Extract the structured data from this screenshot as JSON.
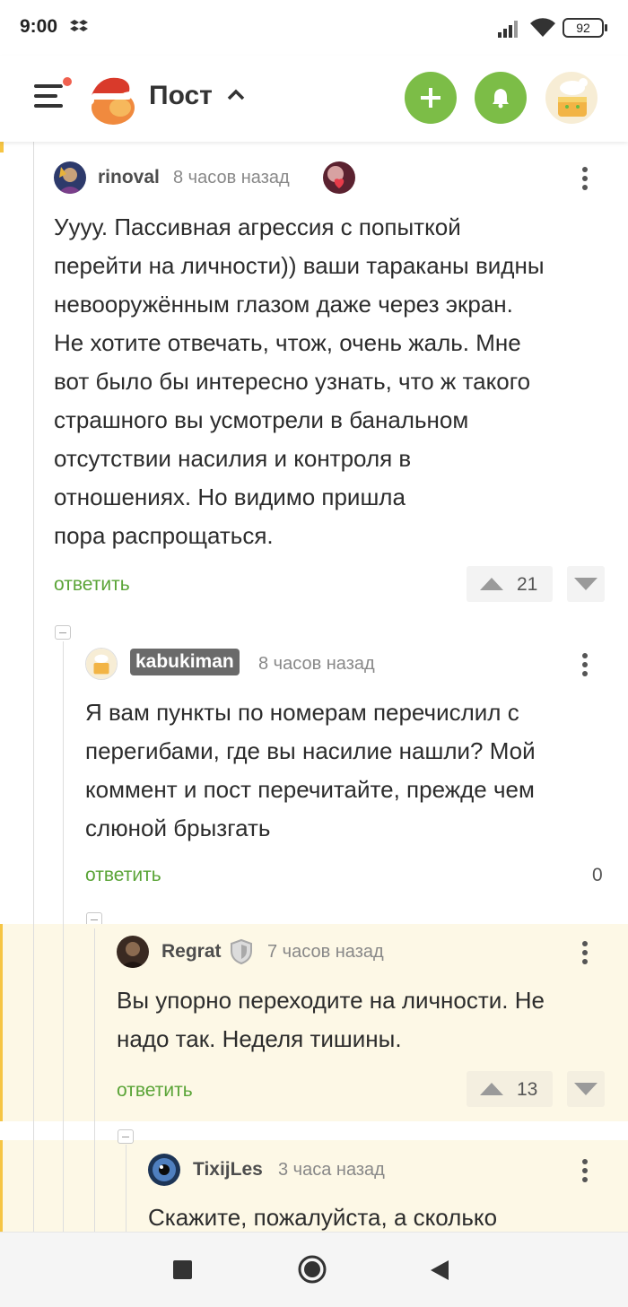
{
  "status_bar": {
    "time": "9:00",
    "battery": "92"
  },
  "header": {
    "title": "Пост"
  },
  "comments": [
    {
      "author": "rinoval",
      "time": "8 часов назад",
      "lines": [
        "Уууу. Пассивная агрессия с попыткой",
        "перейти на личности)) ваши тараканы видны",
        "невооружённым глазом даже через экран.",
        "Не хотите отвечать, чтож, очень жаль. Мне",
        "вот было бы интересно узнать, что ж такого",
        "страшного вы усмотрели в банальном",
        "отсутствии насилия и контроля в",
        "отношениях. Но видимо пришла",
        "пора распрощаться."
      ],
      "reply": "ответить",
      "rating": "21"
    },
    {
      "author": "kabukiman",
      "time": "8 часов назад",
      "lines": [
        "Я вам пункты по номерам перечислил с",
        "перегибами, где вы насилие нашли? Мой",
        "коммент и пост перечитайте, прежде чем",
        "слюной брызгать"
      ],
      "reply": "ответить",
      "rating": "0"
    },
    {
      "author": "Regrat",
      "time": "7 часов назад",
      "lines": [
        "Вы упорно переходите на личности. Не",
        "надо так. Неделя тишины."
      ],
      "reply": "ответить",
      "rating": "13"
    },
    {
      "author": "TixijLes",
      "time": "3 часа назад",
      "lines": [
        "Скажите, пожалуйста, а сколько"
      ]
    }
  ],
  "colors": {
    "accent_green": "#7cbd47",
    "reply_green": "#5aa437",
    "highlight_bg": "#fdf8e6",
    "highlight_bar": "#f6c544"
  },
  "icons": [
    "menu-icon",
    "add-icon",
    "bell-icon",
    "shield-icon",
    "kebab-icon",
    "arrow-up-icon",
    "arrow-down-icon",
    "stop-icon",
    "home-icon",
    "back-icon"
  ]
}
